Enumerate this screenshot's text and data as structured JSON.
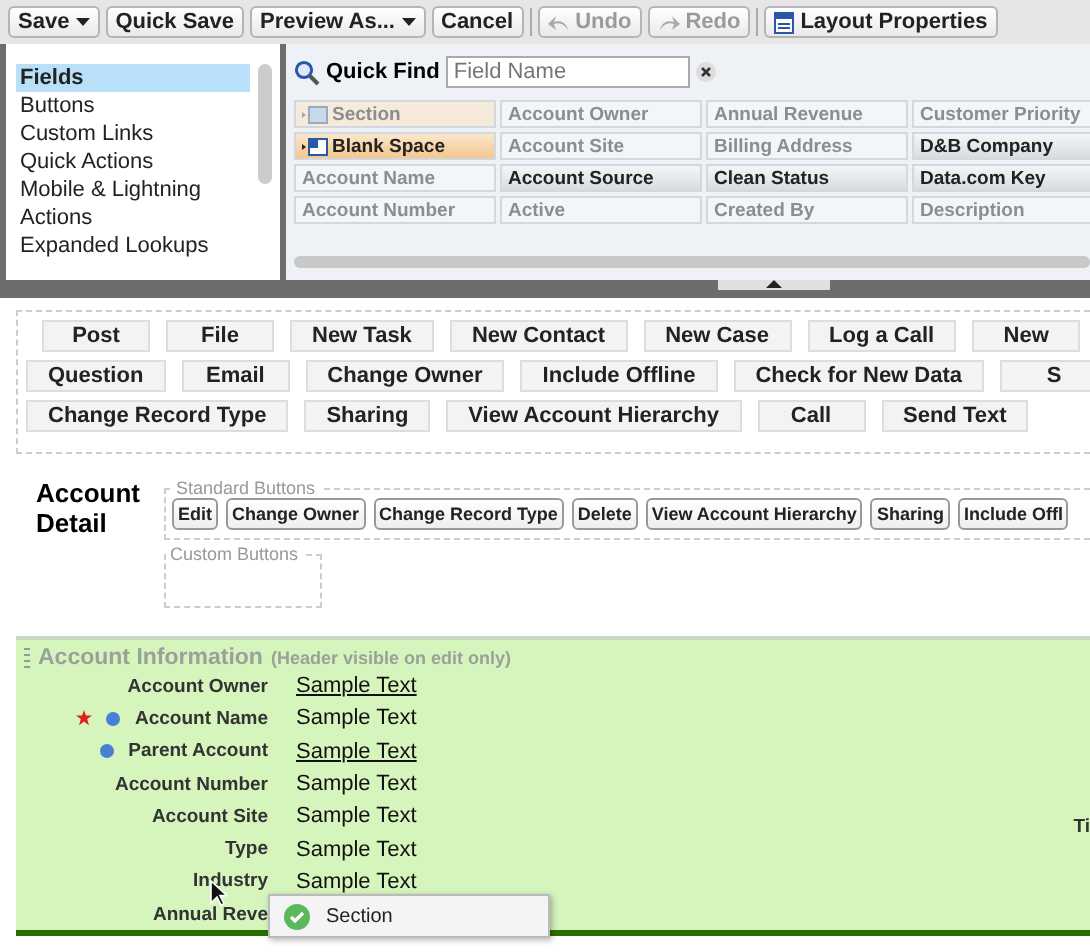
{
  "toolbar": [
    {
      "label": "Save",
      "kind": "split",
      "disabled": false
    },
    {
      "label": "Quick Save",
      "kind": "button",
      "disabled": false
    },
    {
      "label": "Preview As...",
      "kind": "dropdown",
      "disabled": false
    },
    {
      "label": "Cancel",
      "kind": "button",
      "disabled": false
    },
    {
      "label": "Undo",
      "kind": "undo",
      "disabled": true
    },
    {
      "label": "Redo",
      "kind": "redo",
      "disabled": true
    },
    {
      "label": "Layout Properties",
      "kind": "props",
      "disabled": false
    }
  ],
  "palette": {
    "categories": [
      {
        "label": "Fields",
        "selected": true
      },
      {
        "label": "Buttons",
        "selected": false
      },
      {
        "label": "Custom Links",
        "selected": false
      },
      {
        "label": "Quick Actions",
        "selected": false
      },
      {
        "label": "Mobile & Lightning Actions",
        "selected": false
      },
      {
        "label": "Expanded Lookups",
        "selected": false
      }
    ],
    "quick_find": {
      "label": "Quick Find",
      "placeholder": "Field Name"
    },
    "fields": [
      {
        "label": "Section",
        "kind": "section",
        "used": true
      },
      {
        "label": "Account Owner",
        "kind": "field",
        "used": true
      },
      {
        "label": "Annual Revenue",
        "kind": "field",
        "used": true
      },
      {
        "label": "Customer Priority",
        "kind": "field",
        "used": true
      },
      {
        "label": "Blank Space",
        "kind": "blank",
        "used": false
      },
      {
        "label": "Account Site",
        "kind": "field",
        "used": true
      },
      {
        "label": "Billing Address",
        "kind": "field",
        "used": true
      },
      {
        "label": "D&B Company",
        "kind": "field",
        "used": false
      },
      {
        "label": "Account Name",
        "kind": "field",
        "used": true
      },
      {
        "label": "Account Source",
        "kind": "field",
        "used": false
      },
      {
        "label": "Clean Status",
        "kind": "field",
        "used": false
      },
      {
        "label": "Data.com Key",
        "kind": "field",
        "used": false
      },
      {
        "label": "Account Number",
        "kind": "field",
        "used": true
      },
      {
        "label": "Active",
        "kind": "field",
        "used": true
      },
      {
        "label": "Created By",
        "kind": "field",
        "used": true
      },
      {
        "label": "Description",
        "kind": "field",
        "used": true
      }
    ]
  },
  "actions": [
    [
      "Post",
      "File",
      "New Task",
      "New Contact",
      "New Case",
      "Log a Call",
      "New"
    ],
    [
      "Question",
      "Email",
      "Change Owner",
      "Include Offline",
      "Check for New Data",
      "S"
    ],
    [
      "Change Record Type",
      "Sharing",
      "View Account Hierarchy",
      "Call",
      "Send Text"
    ]
  ],
  "detail": {
    "title": "Account Detail",
    "standard_legend": "Standard Buttons",
    "standard_buttons": [
      "Edit",
      "Change Owner",
      "Change Record Type",
      "Delete",
      "View Account Hierarchy",
      "Sharing",
      "Include Offl"
    ],
    "custom_legend": "Custom Buttons"
  },
  "section": {
    "title": "Account Information",
    "note": "(Header visible on edit only)",
    "right_label": "Ti",
    "rows": [
      {
        "label": "Account Owner",
        "value": "Sample Text",
        "link": true,
        "required": false,
        "marked": false
      },
      {
        "label": "Account Name",
        "value": "Sample Text",
        "link": false,
        "required": true,
        "marked": true
      },
      {
        "label": "Parent Account",
        "value": "Sample Text",
        "link": true,
        "required": false,
        "marked": true
      },
      {
        "label": "Account Number",
        "value": "Sample Text",
        "link": false,
        "required": false,
        "marked": false
      },
      {
        "label": "Account Site",
        "value": "Sample Text",
        "link": false,
        "required": false,
        "marked": false
      },
      {
        "label": "Type",
        "value": "Sample Text",
        "link": false,
        "required": false,
        "marked": false
      },
      {
        "label": "Industry",
        "value": "Sample Text",
        "link": false,
        "required": false,
        "marked": false
      },
      {
        "label": "Annual Reve",
        "required": false,
        "marked": false
      }
    ],
    "tooltip": "Section"
  }
}
